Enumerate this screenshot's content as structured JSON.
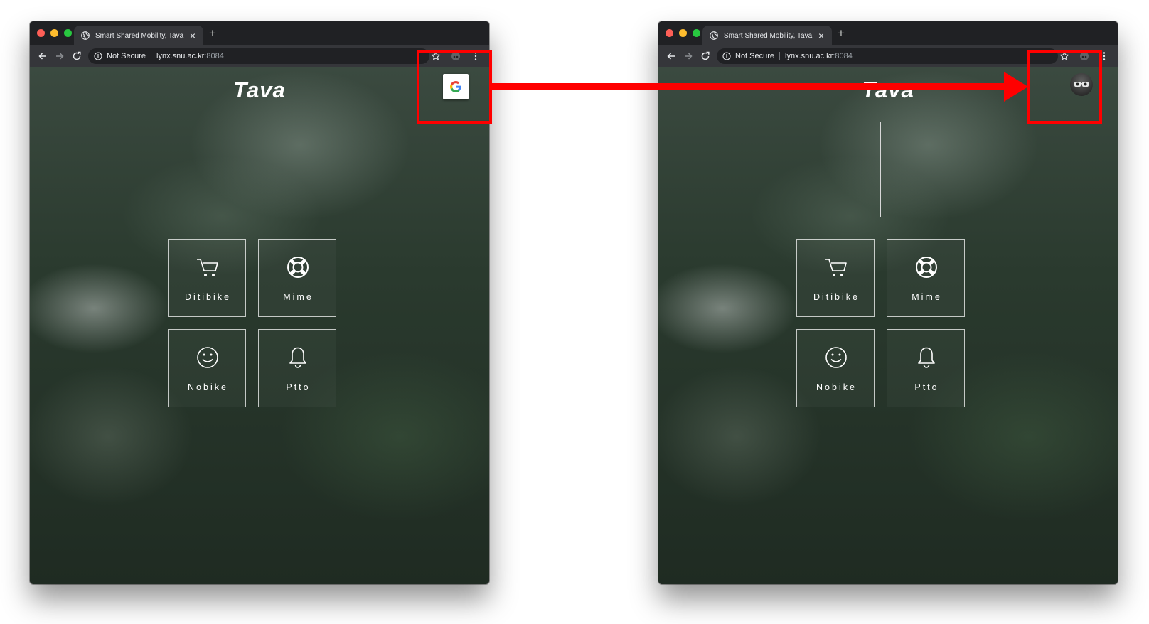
{
  "browser_windows": [
    {
      "tab": {
        "title": "Smart Shared Mobility, Tava",
        "close_glyph": "×",
        "new_tab_glyph": "+"
      },
      "address_bar": {
        "security_text": "Not Secure",
        "url_host": "lynx.snu.ac.kr",
        "url_port": ":8084"
      },
      "page": {
        "title": "Tava",
        "menu_tiles": [
          {
            "label": "Ditibike",
            "icon": "cart-icon"
          },
          {
            "label": "Mime",
            "icon": "lifebuoy-icon"
          },
          {
            "label": "Nobike",
            "icon": "smiley-icon"
          },
          {
            "label": "Ptto",
            "icon": "bell-icon"
          }
        ],
        "auth_control": {
          "type": "google-sign-in-button",
          "glyph": "G"
        }
      }
    },
    {
      "tab": {
        "title": "Smart Shared Mobility, Tava",
        "close_glyph": "×",
        "new_tab_glyph": "+"
      },
      "address_bar": {
        "security_text": "Not Secure",
        "url_host": "lynx.snu.ac.kr",
        "url_port": ":8084"
      },
      "page": {
        "title": "Tava",
        "menu_tiles": [
          {
            "label": "Ditibike",
            "icon": "cart-icon"
          },
          {
            "label": "Mime",
            "icon": "lifebuoy-icon"
          },
          {
            "label": "Nobike",
            "icon": "smiley-icon"
          },
          {
            "label": "Ptto",
            "icon": "bell-icon"
          }
        ],
        "auth_control": {
          "type": "user-avatar"
        }
      }
    }
  ],
  "annotations": {
    "highlight_color": "#ff0000",
    "arrow_direction": "left-to-right"
  },
  "colors": {
    "browser_frame": "#202124",
    "toolbar": "#35363a",
    "tile_border": "#ffffff",
    "google_blue": "#4285F4",
    "google_red": "#EA4335",
    "google_yellow": "#FBBC05",
    "google_green": "#34A853"
  }
}
